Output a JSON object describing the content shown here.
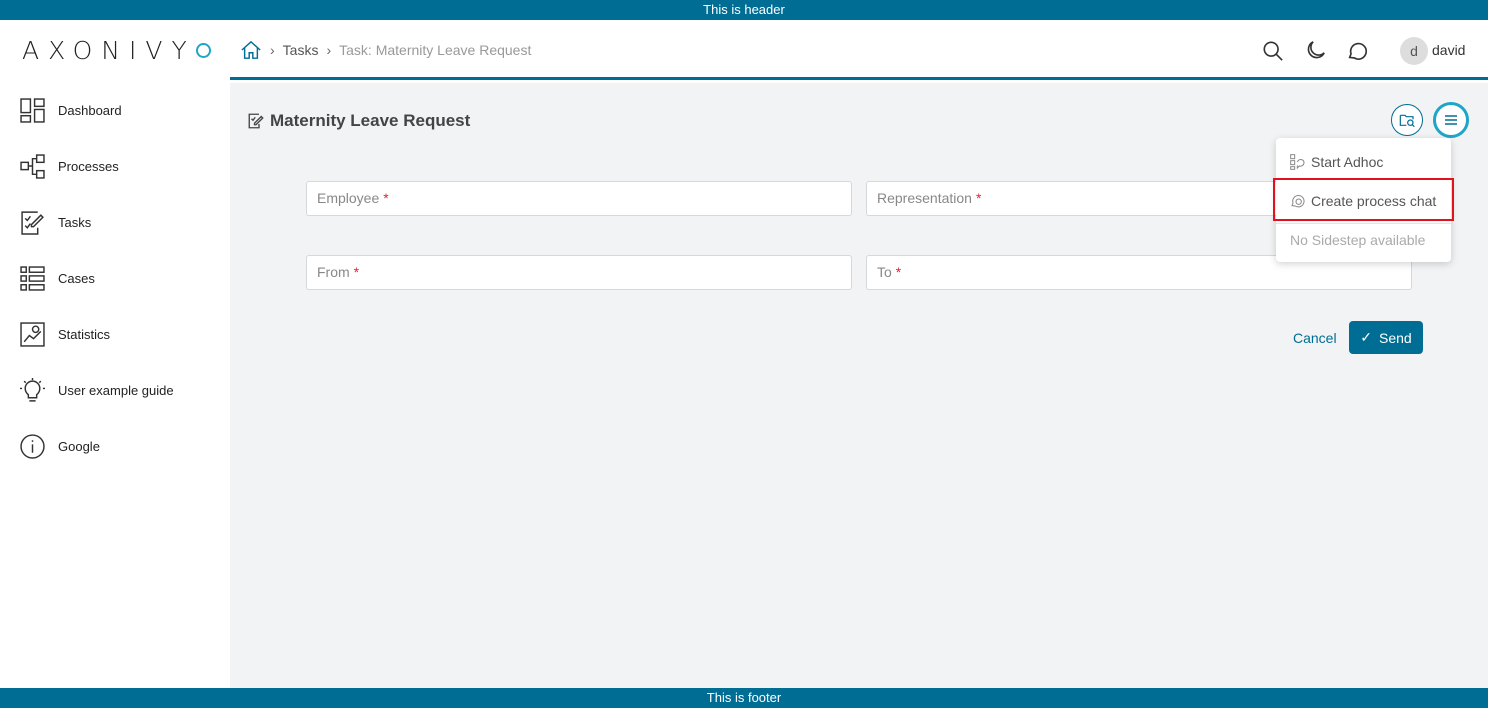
{
  "banners": {
    "header": "This is header",
    "footer": "This is footer"
  },
  "logo": {
    "text": "AXONIVY"
  },
  "sidebar": {
    "items": [
      {
        "label": "Dashboard",
        "icon": "dashboard-icon"
      },
      {
        "label": "Processes",
        "icon": "processes-icon"
      },
      {
        "label": "Tasks",
        "icon": "tasks-icon"
      },
      {
        "label": "Cases",
        "icon": "cases-icon"
      },
      {
        "label": "Statistics",
        "icon": "statistics-icon"
      },
      {
        "label": "User example guide",
        "icon": "lightbulb-icon"
      },
      {
        "label": "Google",
        "icon": "info-icon"
      }
    ]
  },
  "breadcrumb": {
    "home_icon": "home-icon",
    "items": [
      "Tasks",
      "Task: Maternity Leave Request"
    ]
  },
  "topbar": {
    "icons": [
      "search-icon",
      "moon-icon",
      "chat-icon"
    ],
    "user": {
      "initial": "d",
      "name": "david"
    }
  },
  "page": {
    "title": "Maternity Leave Request"
  },
  "form": {
    "fields": [
      {
        "label": "Employee",
        "required": "*"
      },
      {
        "label": "Representation",
        "required": "*"
      },
      {
        "label": "From",
        "required": "*"
      },
      {
        "label": "To",
        "required": "*"
      }
    ],
    "cancel": "Cancel",
    "send": "Send"
  },
  "menu": {
    "items": [
      "Start Adhoc",
      "Create process chat",
      "No Sidestep available"
    ]
  },
  "colors": {
    "primary": "#006e94",
    "accent": "#1ea5c9",
    "required": "#d9263a",
    "highlight": "#e0121c"
  }
}
